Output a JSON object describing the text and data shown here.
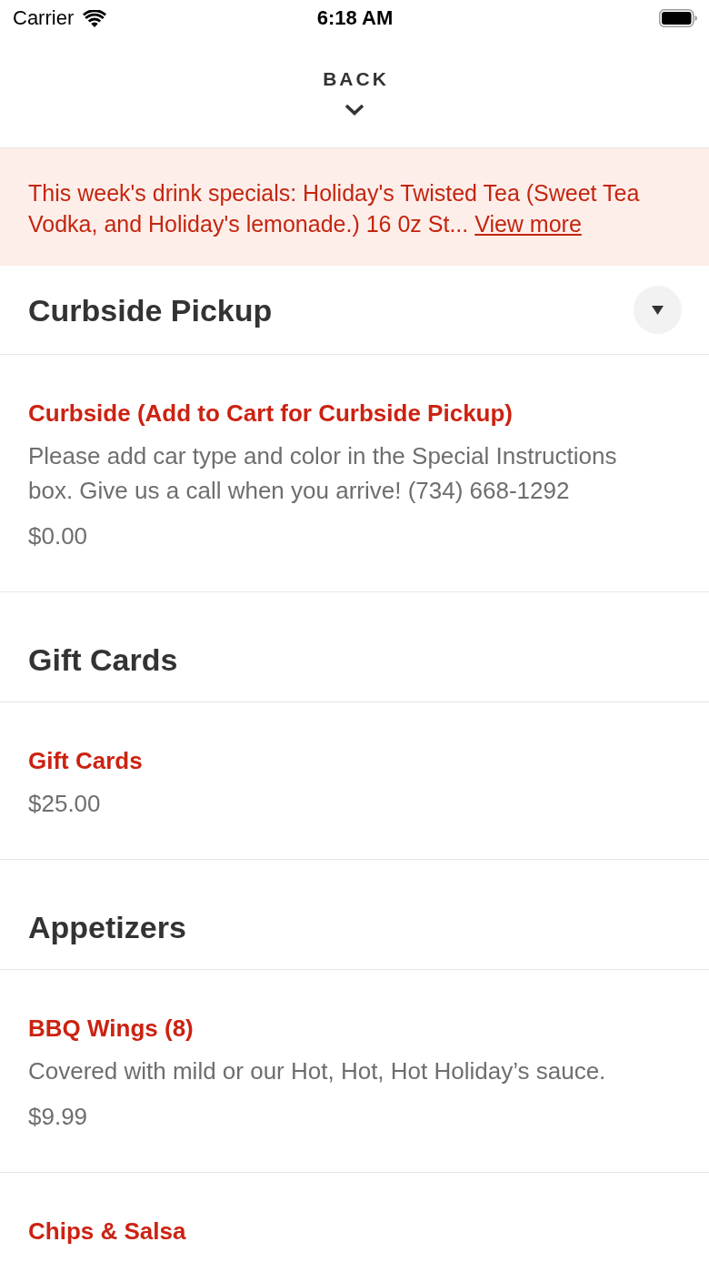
{
  "status_bar": {
    "carrier": "Carrier",
    "time": "6:18 AM"
  },
  "header": {
    "back_label": "BACK"
  },
  "banner": {
    "text": "This week's drink specials: Holiday's Twisted Tea (Sweet Tea Vodka, and Holiday's lemonade.) 16 0z St...",
    "link": "View more"
  },
  "sections": [
    {
      "title": "Curbside Pickup",
      "kind": "dropdown",
      "items": [
        {
          "name": "Curbside (Add to Cart for Curbside Pickup)",
          "description": "Please add car type and color in the Special Instructions box. Give us a call when you arrive! (734) 668-1292",
          "price": "$0.00"
        }
      ]
    },
    {
      "title": "Gift Cards",
      "kind": "plain",
      "items": [
        {
          "name": "Gift Cards",
          "price": "$25.00"
        }
      ]
    },
    {
      "title": "Appetizers",
      "kind": "plain",
      "items": [
        {
          "name": "BBQ Wings (8)",
          "description": "Covered with mild or our Hot, Hot, Hot Holiday’s sauce.",
          "price": "$9.99"
        },
        {
          "name": "Chips & Salsa"
        }
      ]
    }
  ]
}
